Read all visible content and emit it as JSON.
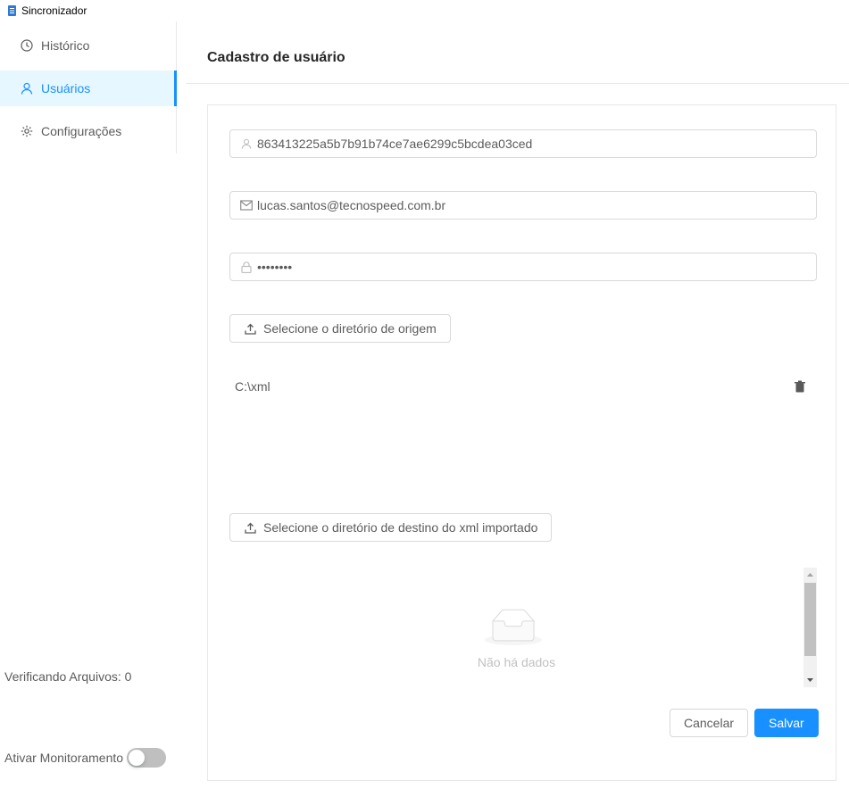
{
  "window": {
    "title": "Sincronizador"
  },
  "sidebar": {
    "items": [
      {
        "label": "Histórico",
        "icon": "clock-icon",
        "active": false
      },
      {
        "label": "Usuários",
        "icon": "user-icon",
        "active": true
      },
      {
        "label": "Configurações",
        "icon": "gear-icon",
        "active": false
      }
    ],
    "status": "Verificando Arquivos: 0",
    "monitor_label": "Ativar Monitoramento",
    "monitor_enabled": false
  },
  "page": {
    "title": "Cadastro de usuário"
  },
  "form": {
    "token_value": "863413225a5b7b91b74ce7ae6299c5bcdea03ced",
    "email_value": "lucas.santos@tecnospeed.com.br",
    "password_value": "••••••••",
    "source_button": "Selecione o diretório de origem",
    "source_path": "C:\\xml",
    "dest_button": "Selecione o diretório de destino do xml importado",
    "empty_text": "Não há dados",
    "cancel_label": "Cancelar",
    "save_label": "Salvar"
  },
  "colors": {
    "primary": "#1890ff",
    "active_bg": "#e6f7ff",
    "border": "#d9d9d9"
  }
}
